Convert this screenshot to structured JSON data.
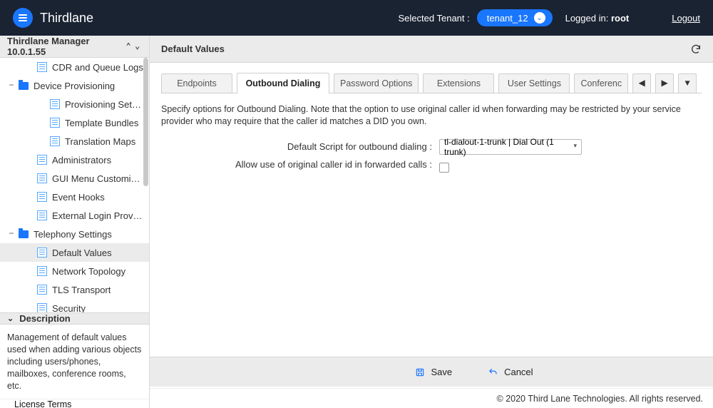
{
  "header": {
    "brand": "Thirdlane",
    "selected_tenant_label": "Selected Tenant :",
    "tenant": "tenant_12",
    "logged_in_label": "Logged in:",
    "logged_in_user": "root",
    "logout": "Logout"
  },
  "sidebar": {
    "title": "Thirdlane Manager 10.0.1.55",
    "items": [
      {
        "label": "CDR and Queue Logs",
        "type": "doc",
        "indent": 1
      },
      {
        "label": "Device Provisioning",
        "type": "folder",
        "indent": 2,
        "expander": "−"
      },
      {
        "label": "Provisioning Setti…",
        "type": "doc",
        "indent": 3
      },
      {
        "label": "Template Bundles",
        "type": "doc",
        "indent": 3
      },
      {
        "label": "Translation Maps",
        "type": "doc",
        "indent": 3
      },
      {
        "label": "Administrators",
        "type": "doc",
        "indent": 1
      },
      {
        "label": "GUI Menu Customiz…",
        "type": "doc",
        "indent": 1
      },
      {
        "label": "Event Hooks",
        "type": "doc",
        "indent": 1
      },
      {
        "label": "External Login Provi…",
        "type": "doc",
        "indent": 1
      },
      {
        "label": "Telephony Settings",
        "type": "folder",
        "indent": 2,
        "expander": "−"
      },
      {
        "label": "Default Values",
        "type": "doc",
        "indent": 1,
        "selected": true
      },
      {
        "label": "Network Topology",
        "type": "doc",
        "indent": 1
      },
      {
        "label": "TLS Transport",
        "type": "doc",
        "indent": 1
      },
      {
        "label": "Security",
        "type": "doc",
        "indent": 1
      }
    ],
    "description_title": "Description",
    "description_body": "Management of default values used when adding various objects including users/phones, mailboxes, conference rooms, etc.",
    "license": "License Terms"
  },
  "main": {
    "title": "Default Values",
    "tabs": [
      "Endpoints",
      "Outbound Dialing",
      "Password Options",
      "Extensions",
      "User Settings",
      "Conferenc"
    ],
    "active_tab": 1,
    "help": "Specify options for Outbound Dialing. Note that the option to use original caller id when forwarding may be restricted by your service provider who may require that the caller id matches a DID you own.",
    "form": {
      "script_label": "Default Script for outbound dialing :",
      "script_value": "tl-dialout-1-trunk | Dial Out (1 trunk)",
      "allow_orig_label": "Allow use of original caller id in forwarded calls :"
    },
    "actions": {
      "save": "Save",
      "cancel": "Cancel"
    },
    "footer": "© 2020 Third Lane Technologies. All rights reserved."
  }
}
